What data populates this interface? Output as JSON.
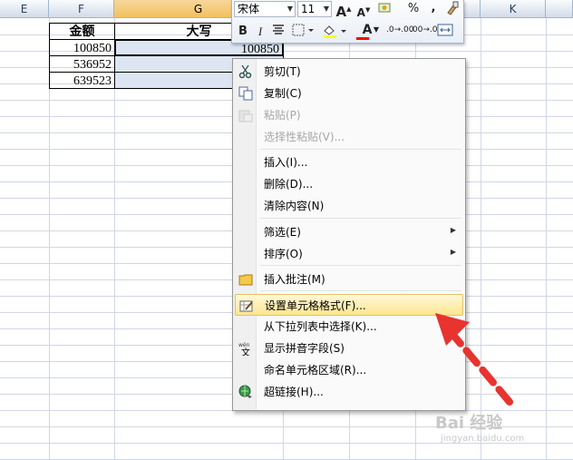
{
  "columns": [
    {
      "letter": "E",
      "selected": false
    },
    {
      "letter": "F",
      "selected": false
    },
    {
      "letter": "G",
      "selected": true
    },
    {
      "letter": "K",
      "selected": false
    }
  ],
  "table": {
    "headers": [
      "金额",
      "大写"
    ],
    "rows": [
      {
        "amount": "100850",
        "upper": "100850"
      },
      {
        "amount": "536952",
        "upper": ""
      },
      {
        "amount": "639523",
        "upper": ""
      }
    ]
  },
  "toolbar": {
    "font_name": "宋体",
    "font_size": "11",
    "grow_font": "A",
    "shrink_font": "A",
    "percent": "%",
    "comma": ",",
    "bold": "B",
    "italic": "I",
    "font_color_letter": "A",
    "increase_decimal": ".0→.00",
    "decrease_decimal": ".00→.0"
  },
  "menu": {
    "items": [
      {
        "label": "剪切(T)",
        "icon": "scissors-icon",
        "disabled": false
      },
      {
        "label": "复制(C)",
        "icon": "copy-icon",
        "disabled": false
      },
      {
        "label": "粘贴(P)",
        "icon": "paste-icon",
        "disabled": true
      },
      {
        "label": "选择性粘贴(V)...",
        "icon": "",
        "disabled": true
      },
      {
        "label": "插入(I)...",
        "icon": "",
        "disabled": false
      },
      {
        "label": "删除(D)...",
        "icon": "",
        "disabled": false
      },
      {
        "label": "清除内容(N)",
        "icon": "",
        "disabled": false
      },
      {
        "label": "筛选(E)",
        "icon": "",
        "disabled": false,
        "submenu": true
      },
      {
        "label": "排序(O)",
        "icon": "",
        "disabled": false,
        "submenu": true
      },
      {
        "label": "插入批注(M)",
        "icon": "comment-icon",
        "disabled": false
      },
      {
        "label": "设置单元格格式(F)...",
        "icon": "format-cells-icon",
        "disabled": false,
        "highlighted": true
      },
      {
        "label": "从下拉列表中选择(K)...",
        "icon": "",
        "disabled": false
      },
      {
        "label": "显示拼音字段(S)",
        "icon": "phonetic-icon",
        "disabled": false
      },
      {
        "label": "命名单元格区域(R)...",
        "icon": "",
        "disabled": false
      },
      {
        "label": "超链接(H)...",
        "icon": "hyperlink-icon",
        "disabled": false
      }
    ]
  },
  "colors": {
    "selected_header": "#f1c15f",
    "menu_highlight": "#fde690",
    "arrow": "#e8332f"
  },
  "watermark": {
    "text": "Bai 经验",
    "url": "jingyan.baidu.com"
  }
}
